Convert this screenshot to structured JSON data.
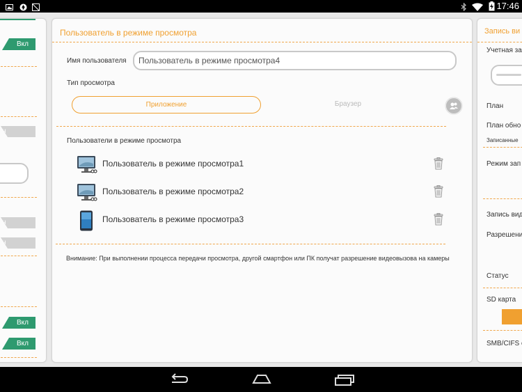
{
  "status_bar": {
    "time": "17:46",
    "left_icons": [
      "image-icon",
      "upload-icon",
      "no-sim-icon"
    ],
    "right_icons": [
      "bluetooth-icon",
      "wifi-icon",
      "battery-charging-icon"
    ]
  },
  "left_panel": {
    "toggles": [
      "Вкл",
      "Вкл",
      "Вкл"
    ],
    "partial_values": [
      "н",
      "н",
      "н"
    ]
  },
  "main": {
    "title": "Пользователь в режиме просмотра",
    "username_label": "Имя пользователя",
    "username_value": "Пользователь в режиме просмотра4",
    "view_type_label": "Тип просмотра",
    "view_type_options": [
      "Приложение",
      "Браузер"
    ],
    "selected_view_type": "Приложение",
    "users_section_label": "Пользователи в режиме просмотра",
    "users": [
      {
        "name": "Пользователь в режиме просмотра1",
        "device_icon": "pc-monitor-icon"
      },
      {
        "name": "Пользователь в режиме просмотра2",
        "device_icon": "pc-monitor-icon"
      },
      {
        "name": "Пользователь в режиме просмотра3",
        "device_icon": "tablet-icon"
      }
    ],
    "note": "Внимание: При выполнении процесса передачи просмотра, другой смартфон или ПК получат разрешение видеовызова на камеры"
  },
  "right_panel": {
    "title": "Запись ви",
    "labels": [
      "Учетная за",
      "План",
      "План обно",
      "Записанные",
      "Режим зап",
      "Запись вид",
      "Разрешени",
      "Статус",
      "SD карта",
      "SMB/CIFS с"
    ]
  },
  "colors": {
    "accent": "#f0a030",
    "toggle_on": "#2e9a6f",
    "toggle_off": "#d2d2d2"
  }
}
